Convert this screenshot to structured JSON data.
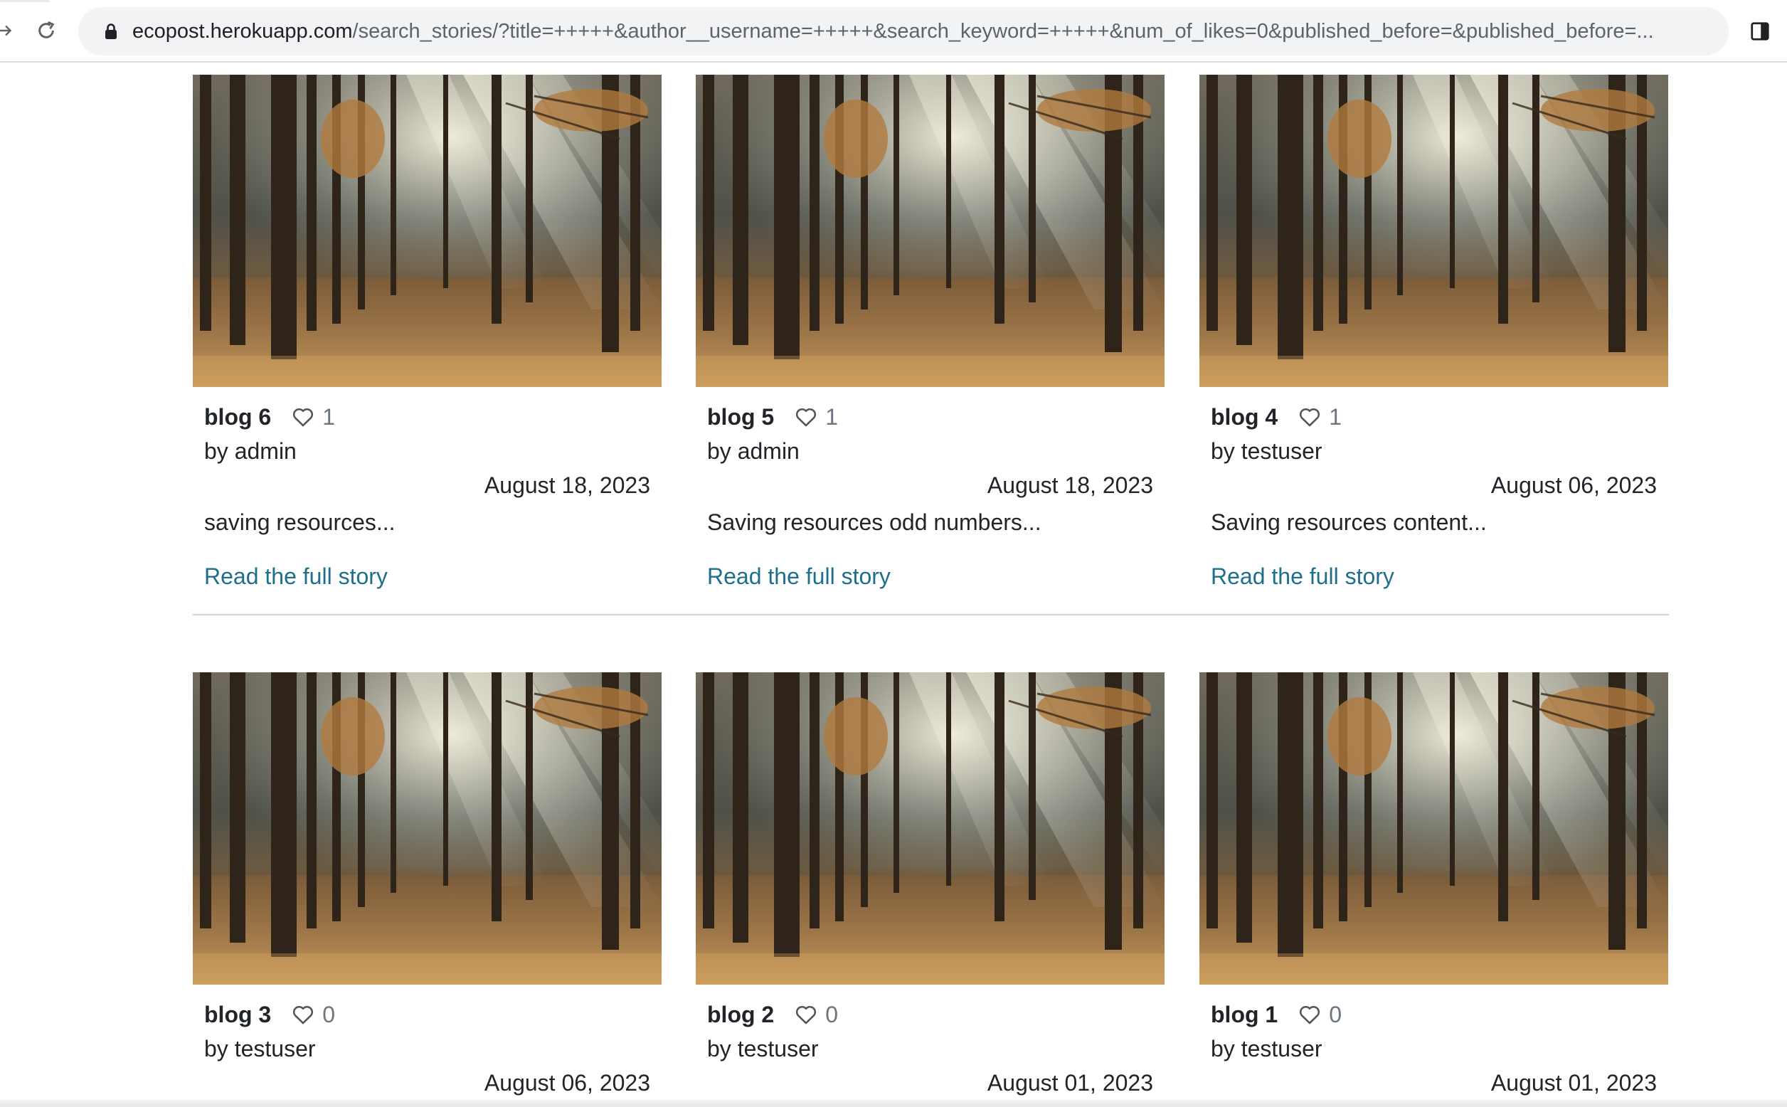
{
  "browser": {
    "url_host": "ecopost.herokuapp.com",
    "url_path": "/search_stories/?title=+++++&author__username=+++++&search_keyword=+++++&num_of_likes=0&published_before=&published_before=..."
  },
  "stories": [
    {
      "title": "blog 6",
      "likes": "1",
      "author": "by admin",
      "date": "August 18, 2023",
      "excerpt": "saving resources...",
      "link": "Read the full story"
    },
    {
      "title": "blog 5",
      "likes": "1",
      "author": "by admin",
      "date": "August 18, 2023",
      "excerpt": "Saving resources odd numbers...",
      "link": "Read the full story"
    },
    {
      "title": "blog 4",
      "likes": "1",
      "author": "by testuser",
      "date": "August 06, 2023",
      "excerpt": "Saving resources content...",
      "link": "Read the full story"
    },
    {
      "title": "blog 3",
      "likes": "0",
      "author": "by testuser",
      "date": "August 06, 2023"
    },
    {
      "title": "blog 2",
      "likes": "0",
      "author": "by testuser",
      "date": "August 01, 2023"
    },
    {
      "title": "blog 1",
      "likes": "0",
      "author": "by testuser",
      "date": "August 01, 2023"
    }
  ],
  "colors": {
    "link": "#1f6f8b",
    "like_icon": "#555555"
  },
  "icons": {
    "reload": "reload-icon",
    "lock": "lock-icon",
    "like": "heart-outline-icon",
    "side_panel": "side-panel-icon"
  }
}
